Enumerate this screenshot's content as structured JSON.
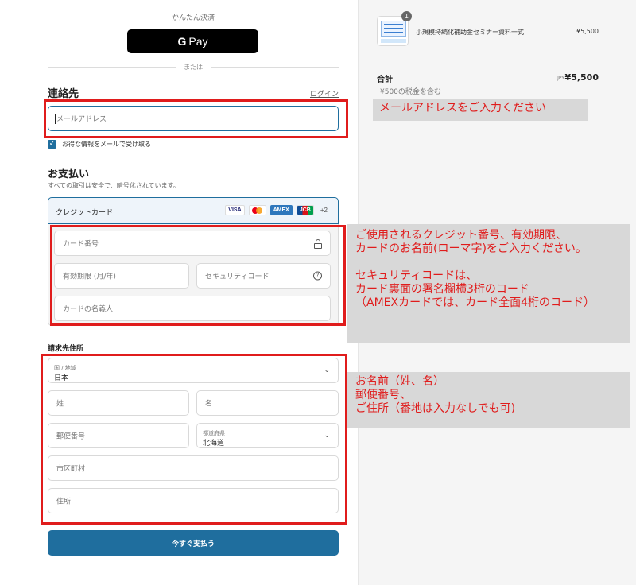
{
  "express": {
    "label": "かんたん決済",
    "gpay_g": "G",
    "gpay_text": "Pay",
    "divider": "または"
  },
  "contact": {
    "heading": "連絡先",
    "login": "ログイン",
    "email_placeholder": "メールアドレス",
    "newsletter_label": "お得な情報をメールで受け取る",
    "newsletter_checked": true
  },
  "payment": {
    "heading": "お支払い",
    "subtitle": "すべての取引は安全で、暗号化されています。",
    "method": "クレジットカード",
    "brands": [
      "VISA",
      "Mastercard",
      "AMEX",
      "JCB"
    ],
    "more_brands": "+2",
    "card_number": "カード番号",
    "expiry": "有効期限 (月/年)",
    "security_code": "セキュリティコード",
    "name_on_card": "カードの名義人"
  },
  "billing": {
    "heading": "請求先住所",
    "country_label": "国 / 地域",
    "country_value": "日本",
    "last_name": "姓",
    "first_name": "名",
    "postal_code": "郵便番号",
    "prefecture_label": "都道府県",
    "prefecture_value": "北海道",
    "city": "市区町村",
    "address": "住所"
  },
  "pay_button": "今すぐ支払う",
  "order": {
    "quantity": "1",
    "product_name": "小規模持続化補助金セミナー資料一式",
    "product_price": "¥5,500",
    "total_label": "合計",
    "currency": "JPY",
    "total_value": "¥5,500",
    "tax_note": "¥500の税金を含む"
  },
  "annotations": {
    "email_note": "メールアドレスをご入力ください",
    "card_note": "ご使用されるクレジット番号、有効期限、\nカードのお名前(ローマ字)をご入力ください。\n\nセキュリティコードは、\nカード裏面の署名欄横3桁のコード\n（AMEXカードでは、カード全面4桁のコード）",
    "address_note": "お名前（姓、名）\n郵便番号、\nご住所（番地は入力なしでも可)"
  },
  "colors": {
    "accent": "#1f6e9e",
    "highlight_red": "#e01c1c",
    "note_bg": "#d8d8d8"
  }
}
